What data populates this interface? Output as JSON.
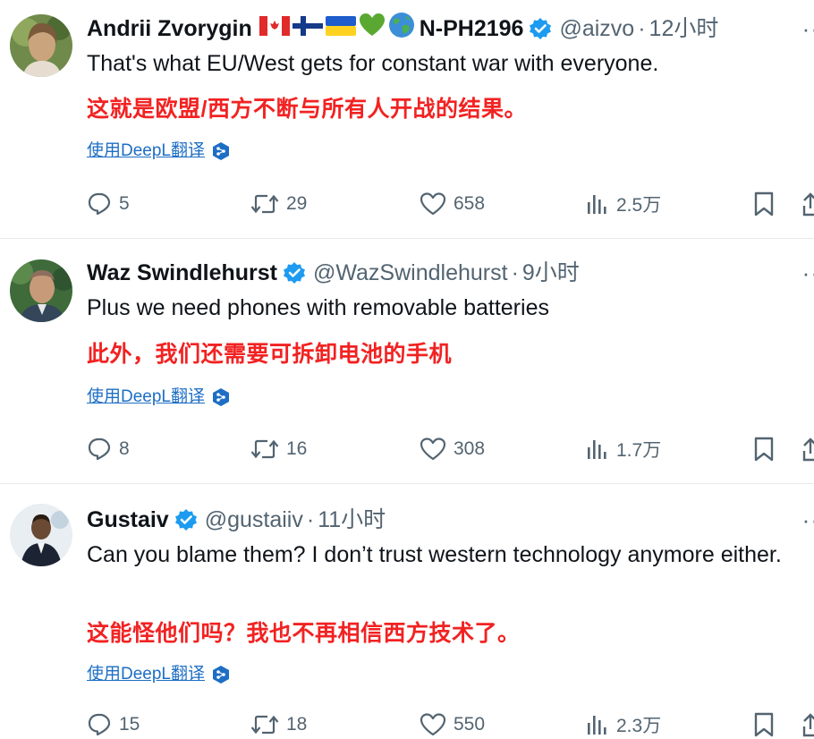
{
  "tweets": [
    {
      "display_name": "Andrii Zvorygin",
      "flags": [
        "canada-flag",
        "finland-flag",
        "ukraine-flag",
        "green-heart",
        "globe"
      ],
      "name_suffix": "N-PH2196",
      "handle": "@aizvo",
      "separator": "·",
      "time": "12小时",
      "text": "That's what EU/West gets for constant war with everyone.",
      "translation": "这就是欧盟/西方不断与所有人开战的结果。",
      "translate_label": "使用DeepL翻译",
      "replies": "5",
      "reposts": "29",
      "likes": "658",
      "views": "2.5万"
    },
    {
      "display_name": "Waz Swindlehurst",
      "handle": "@WazSwindlehurst",
      "separator": "·",
      "time": "9小时",
      "text": "Plus we need phones with removable batteries",
      "translation": "此外，我们还需要可拆卸电池的手机",
      "translate_label": "使用DeepL翻译",
      "replies": "8",
      "reposts": "16",
      "likes": "308",
      "views": "1.7万"
    },
    {
      "display_name": "Gustaiv",
      "handle": "@gustaiiv",
      "separator": "·",
      "time": "11小时",
      "text": "Can you blame them? I don’t trust western technology anymore either.",
      "translation": "这能怪他们吗？我也不再相信西方技术了。",
      "translate_label": "使用DeepL翻译",
      "replies": "15",
      "reposts": "18",
      "likes": "550",
      "views": "2.3万"
    }
  ],
  "ui": {
    "more_label": "··",
    "verified_color": "#1d9bf0",
    "translation_color": "#f22222",
    "link_color": "#1d6ec4"
  }
}
